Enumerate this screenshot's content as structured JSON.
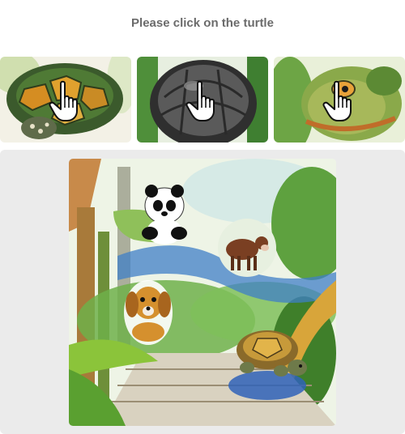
{
  "prompt": "Please click on the turtle",
  "thumbnails": [
    {
      "subject": "turtle shell",
      "icon": "pointer-hand-icon"
    },
    {
      "subject": "turtle shell",
      "icon": "pointer-hand-icon"
    },
    {
      "subject": "turtle head",
      "icon": "pointer-hand-icon"
    }
  ],
  "main_image": {
    "subjects": [
      "panda",
      "cow",
      "dog",
      "turtle"
    ]
  },
  "colors": {
    "prompt_text": "#6b6b6b",
    "panel_background": "#ebebeb"
  }
}
